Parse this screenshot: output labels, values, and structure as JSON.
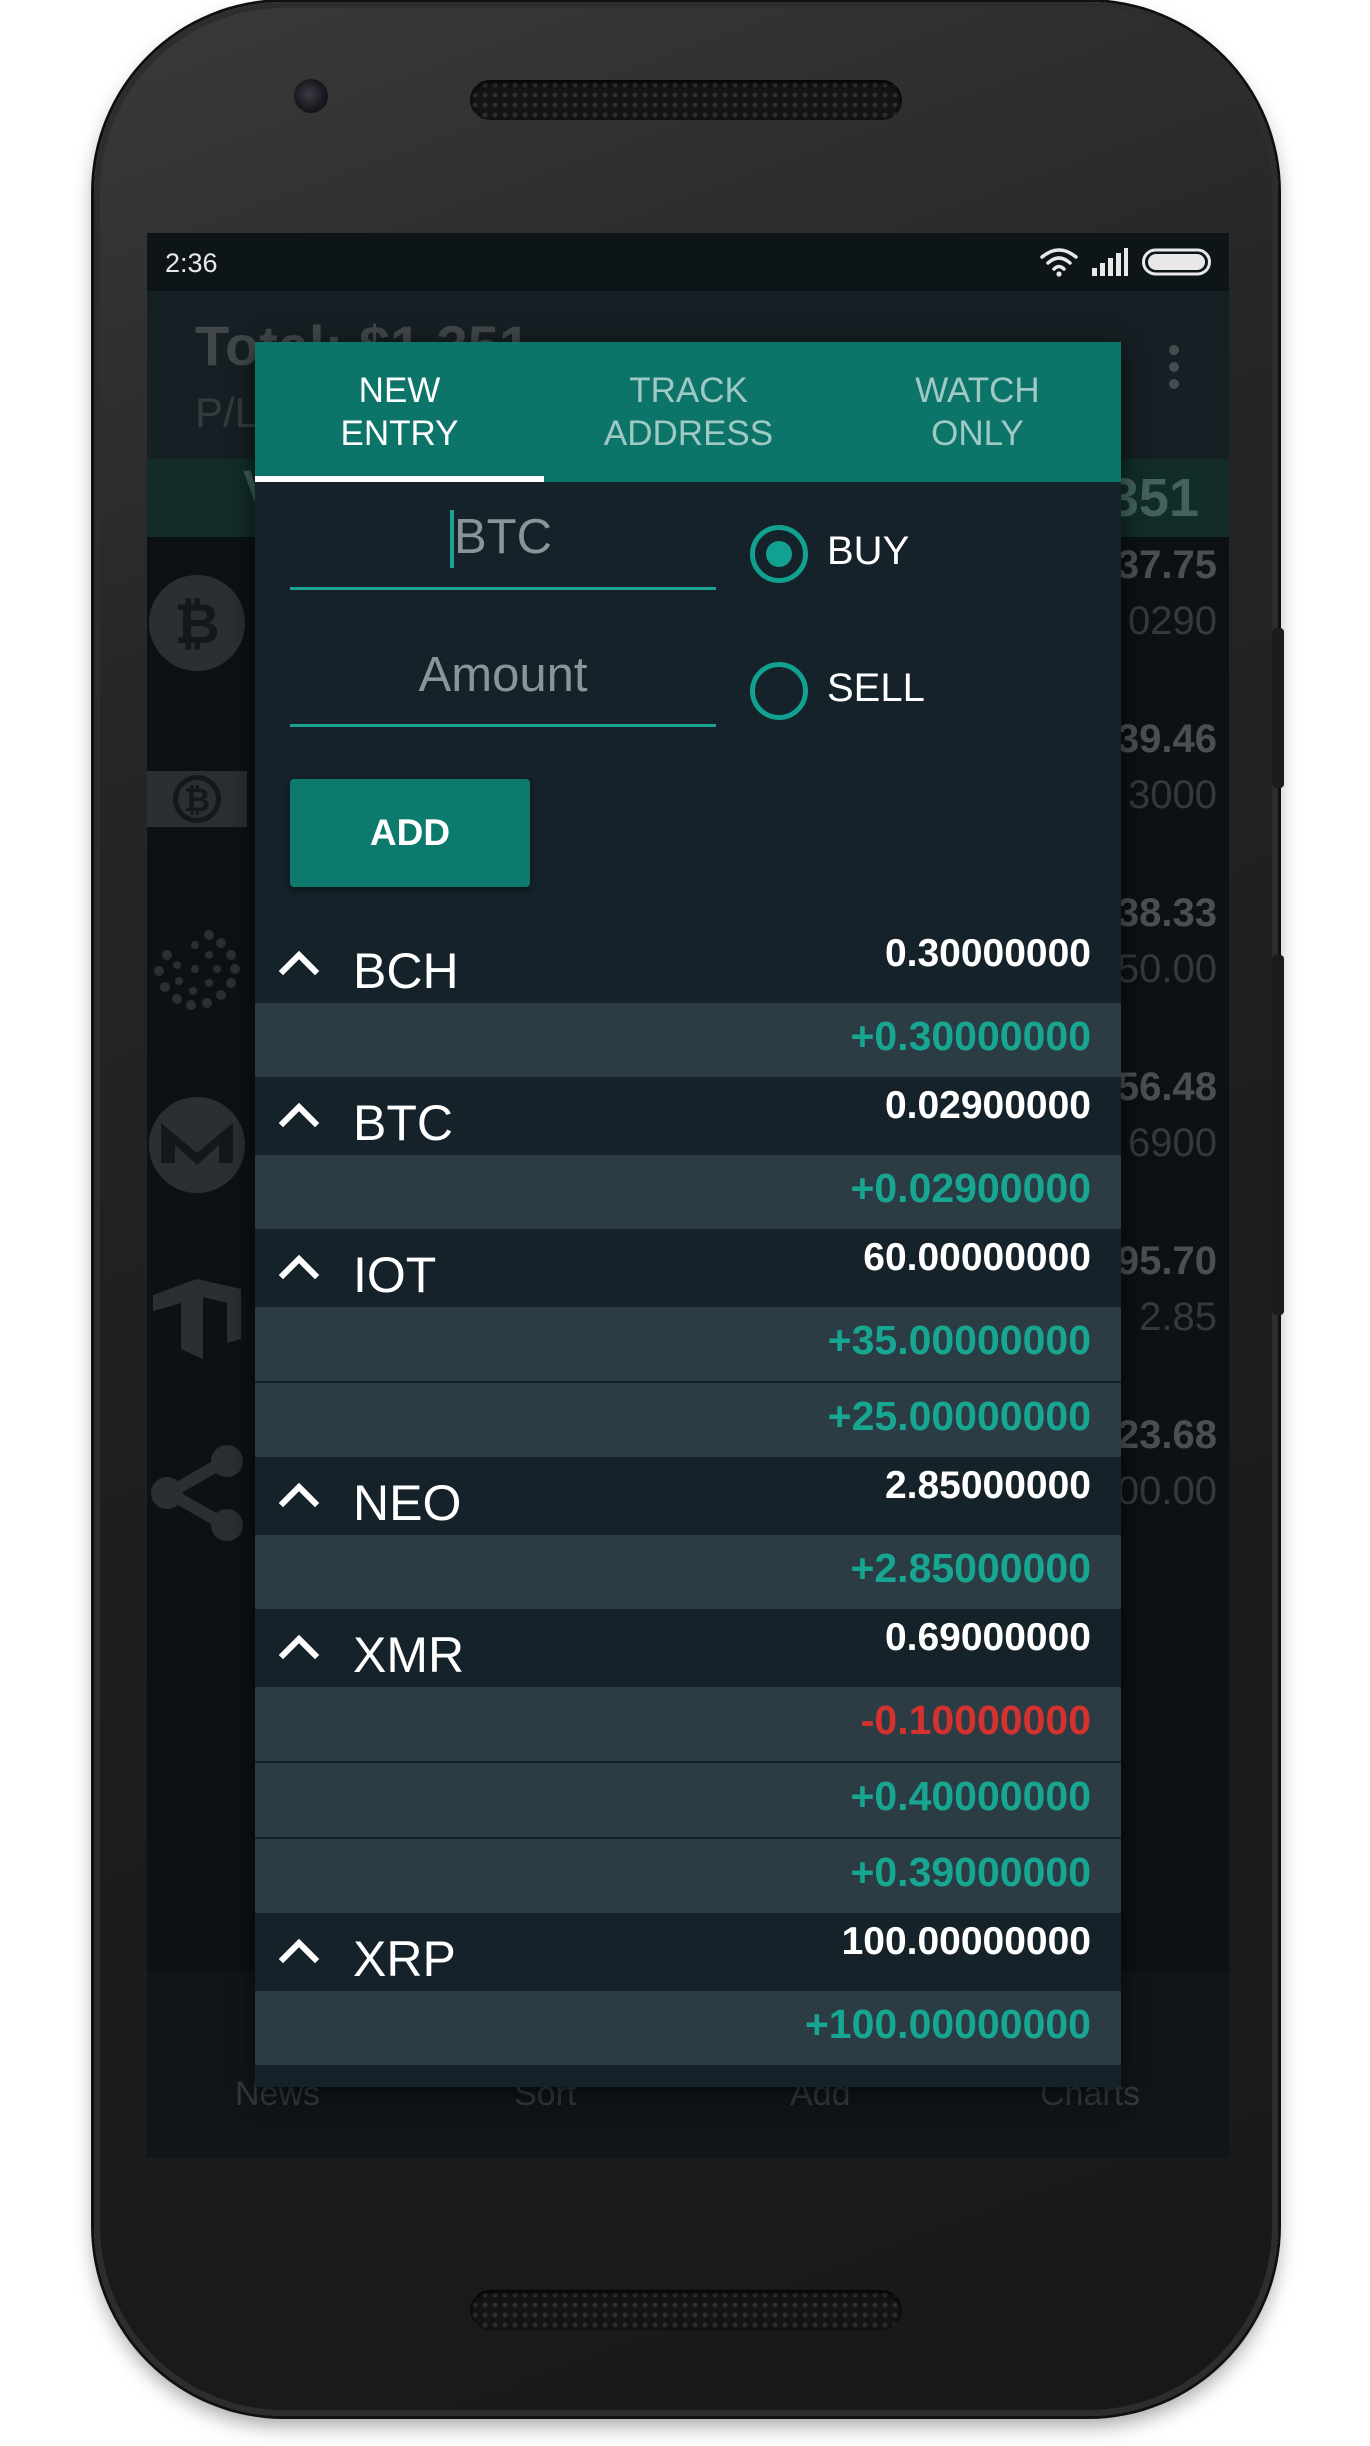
{
  "status_bar": {
    "time": "2:36"
  },
  "background_app": {
    "total": "Total: $1,351",
    "pl": "P/L",
    "bar_left": "V",
    "bar_right": "351",
    "rows": [
      {
        "icon": "bitcoin-icon",
        "value": "37.75",
        "sub": "0290"
      },
      {
        "icon": "bitcoin-cash-icon",
        "value": "39.46",
        "sub": "3000"
      },
      {
        "icon": "iota-icon",
        "value": "38.33",
        "sub": "50.00"
      },
      {
        "icon": "monero-icon",
        "value": "56.48",
        "sub": "6900"
      },
      {
        "icon": "neo-icon",
        "value": "95.70",
        "sub": "2.85"
      },
      {
        "icon": "ripple-icon",
        "value": "23.68",
        "sub": "00.00"
      }
    ],
    "nav": {
      "news": "News",
      "sort": "Sort",
      "add": "Add",
      "charts": "Charts"
    }
  },
  "dialog": {
    "tabs": [
      {
        "label": "NEW\nENTRY",
        "active": true
      },
      {
        "label": "TRACK\nADDRESS",
        "active": false
      },
      {
        "label": "WATCH\nONLY",
        "active": false
      }
    ],
    "symbol_input": {
      "value": "BTC",
      "placeholder": ""
    },
    "amount_input": {
      "value": "",
      "placeholder": "Amount"
    },
    "radio_buy": {
      "label": "BUY",
      "selected": true
    },
    "radio_sell": {
      "label": "SELL",
      "selected": false
    },
    "add_button": "ADD",
    "entries": [
      {
        "symbol": "BCH",
        "total": "0.30000000",
        "transactions": [
          {
            "amount": "+0.30000000",
            "type": "positive"
          }
        ]
      },
      {
        "symbol": "BTC",
        "total": "0.02900000",
        "transactions": [
          {
            "amount": "+0.02900000",
            "type": "positive"
          }
        ]
      },
      {
        "symbol": "IOT",
        "total": "60.00000000",
        "transactions": [
          {
            "amount": "+35.00000000",
            "type": "positive"
          },
          {
            "amount": "+25.00000000",
            "type": "positive"
          }
        ]
      },
      {
        "symbol": "NEO",
        "total": "2.85000000",
        "transactions": [
          {
            "amount": "+2.85000000",
            "type": "positive"
          }
        ]
      },
      {
        "symbol": "XMR",
        "total": "0.69000000",
        "transactions": [
          {
            "amount": "-0.10000000",
            "type": "negative"
          },
          {
            "amount": "+0.40000000",
            "type": "positive"
          },
          {
            "amount": "+0.39000000",
            "type": "positive"
          }
        ]
      },
      {
        "symbol": "XRP",
        "total": "100.00000000",
        "transactions": [
          {
            "amount": "+100.00000000",
            "type": "positive"
          }
        ]
      }
    ]
  },
  "colors": {
    "accent": "#0c7469",
    "positive": "#16a691",
    "negative": "#d4322e",
    "dialog_bg": "#15222a",
    "row_bg": "#2b3c44"
  }
}
